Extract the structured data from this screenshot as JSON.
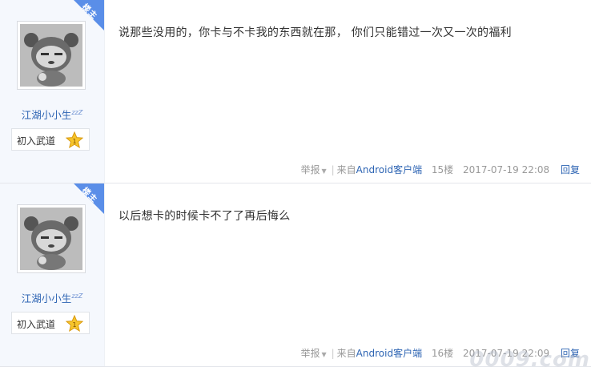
{
  "posts": [
    {
      "badge": "楼主",
      "username": "江湖小小生",
      "user_suffix": "zzZ",
      "level_name": "初入武道",
      "level_num": "1",
      "content": "说那些没用的，你卡与不卡我的东西就在那， 你们只能错过一次又一次的福利",
      "report": "举报",
      "source_prefix": "来自",
      "source_app": "Android客户端",
      "floor": "15楼",
      "date": "2017-07-19 22:08",
      "reply": "回复"
    },
    {
      "badge": "楼主",
      "username": "江湖小小生",
      "user_suffix": "zzZ",
      "level_name": "初入武道",
      "level_num": "1",
      "content": "以后想卡的时候卡不了了再后悔么",
      "report": "举报",
      "source_prefix": "来自",
      "source_app": "Android客户端",
      "floor": "16楼",
      "date": "2017-07-19 22:09",
      "reply": "回复"
    }
  ],
  "watermark": "0009.com",
  "colors": {
    "link": "#2d64b3",
    "badge": "#5a8ee8",
    "sidebar": "#f5f8fd"
  },
  "icons": {
    "level": "star-icon",
    "report_dropdown": "caret-down-icon"
  }
}
